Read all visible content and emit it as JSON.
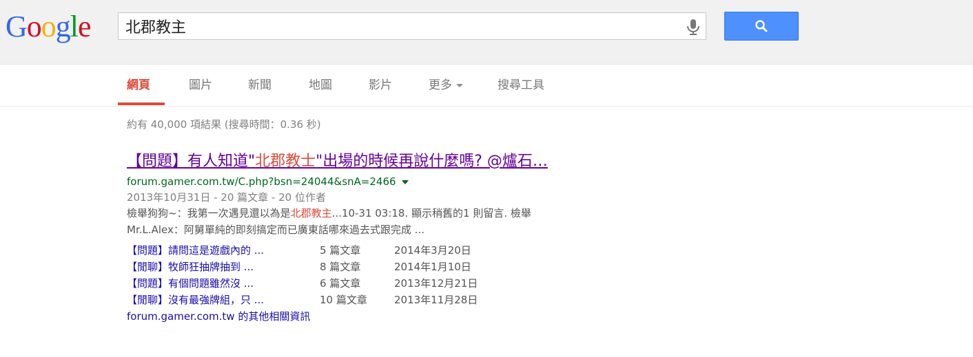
{
  "logo": {
    "text": "Google",
    "letters": [
      "G",
      "o",
      "o",
      "g",
      "l",
      "e"
    ],
    "colors": [
      "#3369e8",
      "#d50f25",
      "#eeb211",
      "#3369e8",
      "#009925",
      "#d50f25"
    ]
  },
  "search": {
    "query": "北郡教主"
  },
  "tabs": [
    {
      "label": "網頁",
      "active": true
    },
    {
      "label": "圖片"
    },
    {
      "label": "新聞"
    },
    {
      "label": "地圖"
    },
    {
      "label": "影片"
    },
    {
      "label": "更多"
    },
    {
      "label": "搜尋工具"
    }
  ],
  "stats": "約有 40,000 項結果 (搜尋時間：0.36 秒)",
  "result": {
    "title_parts": [
      "【問題】有人知道\"",
      "北郡教士",
      "\"出場的時候再說什麼嗎? @爐石…"
    ],
    "url": "forum.gamer.com.tw/C.php?bsn=24044&snA=2466",
    "meta": "2013年10月31日 - 20 篇文章 - 20 位作者",
    "snippet_parts": [
      "檢舉狗狗~：我第一次遇見還以為是",
      "北郡教主",
      "...10-31 03:18. 顯示稍舊的1 則留言. 檢舉"
    ],
    "snippet_line2": "Mr.L.Alex：阿舅單純的即刻搞定而已廣東話哪來過去式跟完成 ..."
  },
  "sublinks": [
    {
      "title": "【問題】請問這是遊戲內的 ...",
      "count": "5 篇文章",
      "date": "2014年3月20日"
    },
    {
      "title": "【閒聊】牧師狂抽牌抽到 ...",
      "count": "8 篇文章",
      "date": "2014年1月10日"
    },
    {
      "title": "【問題】有個問題雖然沒 ...",
      "count": "6 篇文章",
      "date": "2013年12月21日"
    },
    {
      "title": "【閒聊】沒有最強牌組，只 ...",
      "count": "10 篇文章",
      "date": "2013年11月28日"
    }
  ],
  "more_info": {
    "site": "forum.gamer.com.tw",
    "suffix": " 的其他相關資訊"
  },
  "colors": {
    "accent_red": "#dd4b39",
    "link_blue": "#1a0dab",
    "visited": "#660099",
    "url_green": "#006621",
    "button_blue": "#4d90fe"
  }
}
